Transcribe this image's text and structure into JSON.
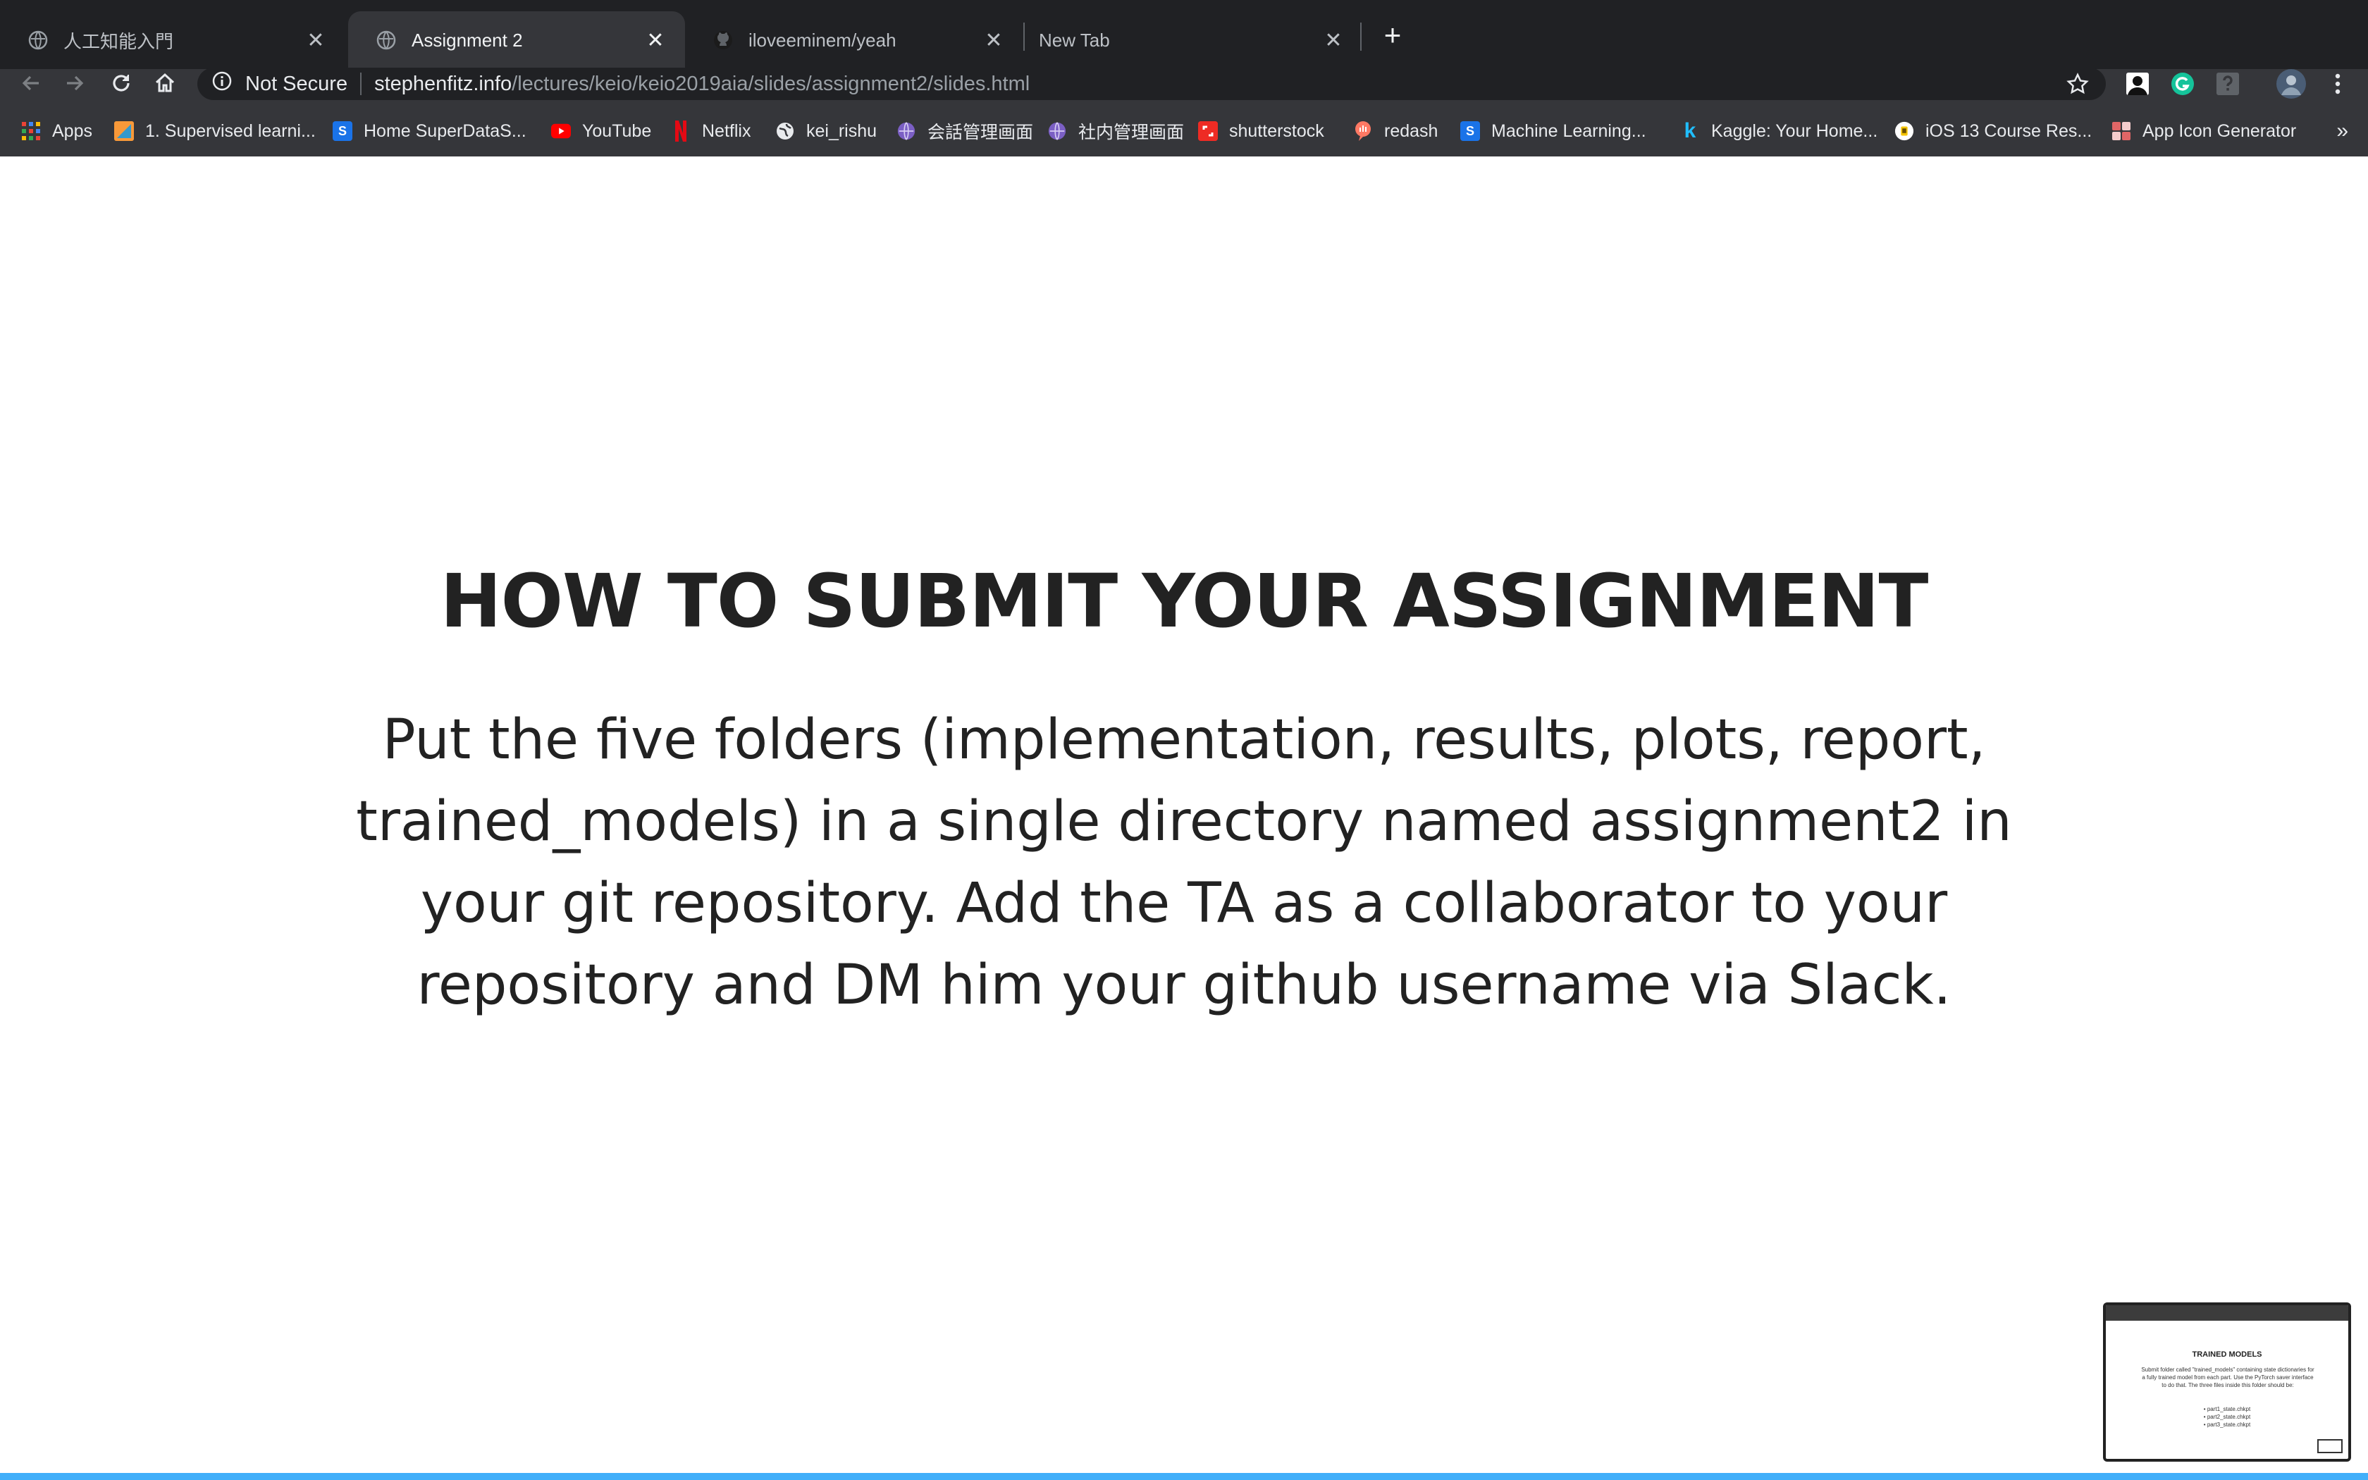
{
  "tabs": [
    {
      "title": "人工知能入門",
      "icon": "globe-icon",
      "active": false
    },
    {
      "title": "Assignment 2",
      "icon": "globe-icon",
      "active": true
    },
    {
      "title": "iloveeminem/yeah",
      "icon": "github-icon",
      "active": false
    },
    {
      "title": "New Tab",
      "icon": "",
      "active": false
    }
  ],
  "omnibox": {
    "security_label": "Not Secure",
    "url_host": "stephenfitz.info",
    "url_path": "/lectures/keio/keio2019aia/slides/assignment2/slides.html"
  },
  "bookmarks": [
    {
      "label": "Apps",
      "icon": "apps-grid-icon",
      "color": "#ea4335"
    },
    {
      "label": "1. Supervised learni...",
      "icon": "sklearn-icon",
      "color": "#f89939"
    },
    {
      "label": "Home SuperDataS...",
      "icon": "superdatascience-icon",
      "color": "#1a73e8"
    },
    {
      "label": "YouTube",
      "icon": "youtube-icon",
      "color": "#ff0000"
    },
    {
      "label": "Netflix",
      "icon": "netflix-icon",
      "color": "#e50914"
    },
    {
      "label": "kei_rishu",
      "icon": "globe-icon",
      "color": "#e8eaed"
    },
    {
      "label": "会話管理画面",
      "icon": "purple-globe-icon",
      "color": "#7b5fc4"
    },
    {
      "label": "社内管理画面",
      "icon": "purple-globe-icon",
      "color": "#7b5fc4"
    },
    {
      "label": "shutterstock",
      "icon": "shutterstock-icon",
      "color": "#ee2b24"
    },
    {
      "label": "redash",
      "icon": "redash-icon",
      "color": "#ff7964"
    },
    {
      "label": "Machine Learning...",
      "icon": "superdatascience-icon",
      "color": "#1a73e8"
    },
    {
      "label": "Kaggle: Your Home...",
      "icon": "kaggle-icon",
      "color": "#20beff"
    },
    {
      "label": "iOS 13 Course Res...",
      "icon": "course-icon",
      "color": "#f5c400"
    },
    {
      "label": "App Icon Generator",
      "icon": "app-icon-generator-icon",
      "color": "#e06666"
    }
  ],
  "bookmarks_more": "»",
  "slide": {
    "title": "HOW TO SUBMIT YOUR ASSIGNMENT",
    "body": "Put the five folders (implementation, results, plots, report, trained_models) in a single directory named assignment2 in your git repository. Add the TA as a collaborator to your repository and DM him your github username via Slack.",
    "progress": 1.0
  },
  "preview": {
    "title": "TRAINED MODELS",
    "body": "Submit folder called \"trained_models\" containing state dictionaries for a fully trained model from each part. Use the PyTorch saver interface to do that. The three files inside this folder should be:",
    "items": [
      "part1_state.chkpt",
      "part2_state.chkpt",
      "part3_state.chkpt"
    ]
  },
  "colors": {
    "tabstrip": "#202124",
    "toolbar": "#35363a",
    "slide_text": "#222222",
    "progress": "#42affa"
  }
}
